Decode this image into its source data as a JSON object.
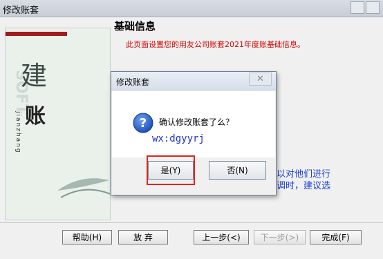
{
  "window": {
    "title": "修改账套"
  },
  "panel": {
    "big_char_1": "建",
    "big_char_2": "账",
    "vertical_text": "jianzhang",
    "faint_text": "SOFT"
  },
  "content": {
    "heading": "基础信息",
    "description": "此页面设置您的用友公司账套2021年度账基础信息。",
    "blue_line_1": "以对他们进行",
    "blue_line_2": "调时，建议选"
  },
  "footer": {
    "help": "帮助(H)",
    "abandon": "放 弃",
    "prev": "上一步(<)",
    "next": "下一步(>)",
    "finish": "完成(F)"
  },
  "dialog": {
    "title": "修改账套",
    "close": "✕",
    "message": "确认修改账套了么？",
    "watermark": "wx:dgyyrj",
    "yes": "是(Y)",
    "no": "否(N)"
  },
  "colors": {
    "accent_red": "#d40000",
    "link_blue": "#1b3fd1",
    "highlight": "#e0251b"
  }
}
